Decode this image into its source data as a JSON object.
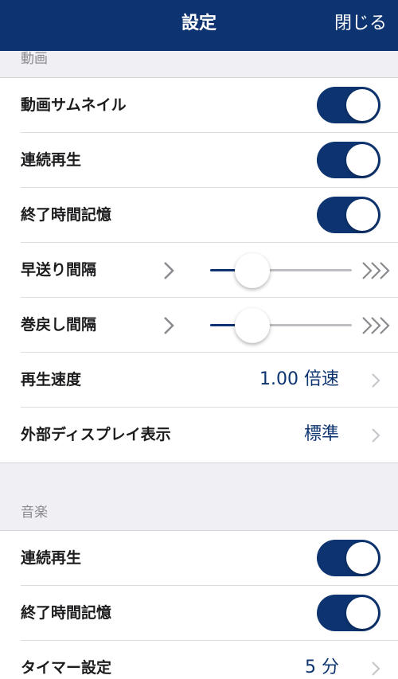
{
  "navbar": {
    "title": "設定",
    "close_label": "閉じる"
  },
  "video": {
    "header": "動画",
    "thumbnail": {
      "label": "動画サムネイル",
      "on": true
    },
    "continuous": {
      "label": "連続再生",
      "on": true
    },
    "resume": {
      "label": "終了時間記憶",
      "on": true
    },
    "fast_forward": {
      "label": "早送り間隔",
      "level": 0.3
    },
    "rewind": {
      "label": "巻戻し間隔",
      "level": 0.3
    },
    "speed": {
      "label": "再生速度",
      "value": "1.00 倍速"
    },
    "external_display": {
      "label": "外部ディスプレイ表示",
      "value": "標準"
    }
  },
  "music": {
    "header": "音楽",
    "continuous": {
      "label": "連続再生",
      "on": true
    },
    "resume": {
      "label": "終了時間記憶",
      "on": true
    },
    "timer": {
      "label": "タイマー設定",
      "value": "5 分"
    }
  },
  "colors": {
    "accent": "#0d3470",
    "background": "#efeff4",
    "chevron": "#c7c7cc"
  }
}
